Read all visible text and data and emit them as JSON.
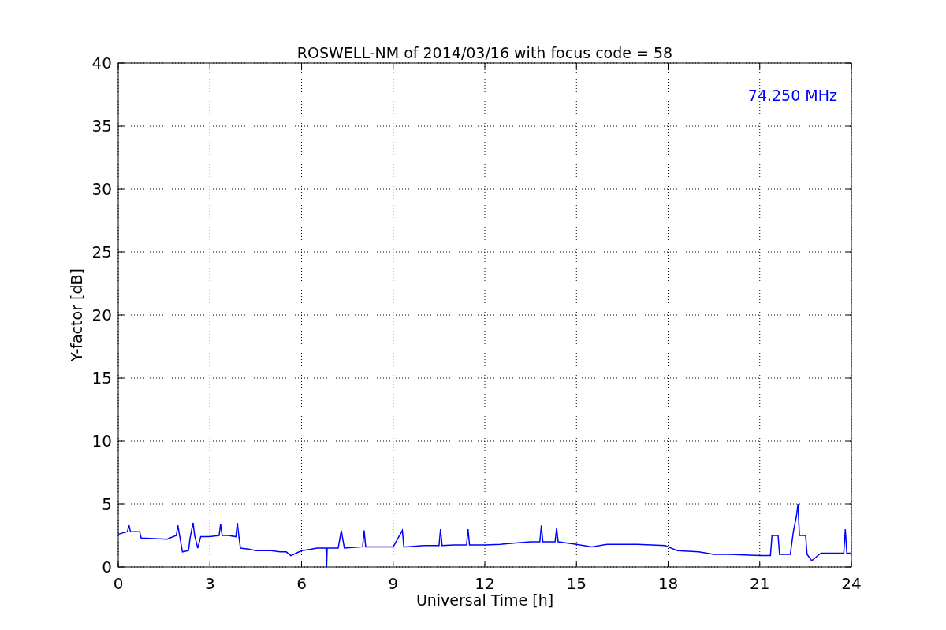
{
  "chart_data": {
    "type": "line",
    "title": "ROSWELL-NM of 2014/03/16 with focus code = 58",
    "xlabel": "Universal Time [h]",
    "ylabel": "Y-factor [dB]",
    "x": [
      0,
      0.3,
      0.35,
      0.4,
      0.7,
      0.75,
      1.6,
      1.9,
      1.95,
      2.0,
      2.1,
      2.3,
      2.35,
      2.45,
      2.5,
      2.6,
      2.7,
      3.0,
      3.3,
      3.35,
      3.4,
      3.6,
      3.85,
      3.9,
      3.95,
      4.0,
      4.3,
      4.5,
      5.0,
      5.3,
      5.5,
      5.65,
      6.0,
      6.3,
      6.5,
      6.8,
      6.82,
      6.84,
      7.2,
      7.3,
      7.4,
      8.0,
      8.05,
      8.1,
      9.0,
      9.3,
      9.35,
      9.4,
      10.0,
      10.5,
      10.55,
      10.6,
      11.0,
      11.4,
      11.45,
      11.5,
      12.0,
      12.5,
      13.0,
      13.5,
      13.8,
      13.85,
      13.9,
      14.0,
      14.3,
      14.35,
      14.4,
      15.0,
      15.5,
      16.0,
      17.0,
      17.9,
      18.0,
      18.3,
      19.0,
      19.5,
      20.0,
      21.0,
      21.35,
      21.4,
      21.6,
      21.65,
      22.0,
      22.1,
      22.2,
      22.25,
      22.3,
      22.5,
      22.55,
      22.7,
      23.0,
      23.75,
      23.8,
      23.85,
      24.0
    ],
    "series": [
      {
        "name": "74.250 MHz",
        "color": "#0000ff",
        "values": [
          2.6,
          2.8,
          3.3,
          2.8,
          2.8,
          2.3,
          2.2,
          2.5,
          3.3,
          2.6,
          1.2,
          1.3,
          2.3,
          3.5,
          2.5,
          1.5,
          2.4,
          2.4,
          2.5,
          3.4,
          2.5,
          2.5,
          2.4,
          3.5,
          2.4,
          1.5,
          1.4,
          1.3,
          1.3,
          1.2,
          1.2,
          0.9,
          1.3,
          1.4,
          1.5,
          1.5,
          0,
          1.5,
          1.5,
          2.9,
          1.5,
          1.6,
          2.9,
          1.6,
          1.6,
          2.9,
          1.6,
          1.6,
          1.7,
          1.7,
          3.0,
          1.7,
          1.75,
          1.75,
          3.0,
          1.75,
          1.75,
          1.8,
          1.9,
          2.0,
          2.0,
          3.3,
          2.0,
          2.0,
          2.0,
          3.1,
          2.0,
          1.8,
          1.6,
          1.8,
          1.8,
          1.7,
          1.6,
          1.3,
          1.2,
          1.0,
          1.0,
          0.9,
          0.9,
          2.5,
          2.5,
          1.0,
          1.0,
          2.8,
          4.0,
          5.0,
          2.5,
          2.5,
          1.0,
          0.5,
          1.1,
          1.1,
          3.0,
          1.1,
          1.1
        ]
      }
    ],
    "xlim": [
      0,
      24
    ],
    "ylim": [
      0,
      40
    ],
    "xticks": [
      0,
      3,
      6,
      9,
      12,
      15,
      18,
      21,
      24
    ],
    "yticks": [
      0,
      5,
      10,
      15,
      20,
      25,
      30,
      35,
      40
    ],
    "grid": true
  }
}
